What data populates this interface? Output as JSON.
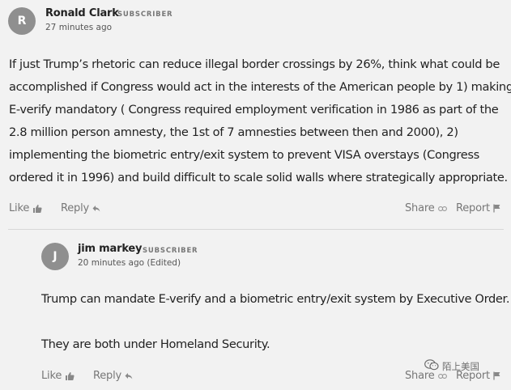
{
  "comment": {
    "avatar_initial": "R",
    "author": "Ronald Clark",
    "badge": "SUBSCRIBER",
    "time": "27 minutes ago",
    "lines": [
      "If just Trump’s rhetoric can reduce illegal border crossings by 26%, think what could be",
      "accomplished if Congress would act in the interests of the American people by 1) making",
      "E-verify mandatory ( Congress required employment verification in 1986 as part of the",
      "2.8 million person amnesty, the 1st of 7 amnesties between then and 2000), 2)",
      "implementing the biometric entry/exit system to prevent VISA overstays (Congress",
      "ordered it in 1996) and build difficult to scale solid walls where strategically appropriate."
    ],
    "actions": {
      "like": "Like",
      "reply": "Reply",
      "share": "Share",
      "report": "Report"
    }
  },
  "reply": {
    "avatar_initial": "J",
    "author": "jim markey",
    "badge": "SUBSCRIBER",
    "time": "20 minutes ago (Edited)",
    "paragraphs": [
      "Trump can mandate E-verify and a biometric entry/exit system by Executive Order.",
      "They are both under Homeland Security."
    ],
    "actions": {
      "like": "Like",
      "reply": "Reply",
      "share": "Share",
      "report": "Report"
    }
  },
  "watermark": {
    "text": "陌上美国",
    "icon": "wechat-icon"
  },
  "colors": {
    "background": "#f2f2f2",
    "avatar": "#8f8f8f",
    "text": "#222222",
    "muted": "#777777"
  }
}
